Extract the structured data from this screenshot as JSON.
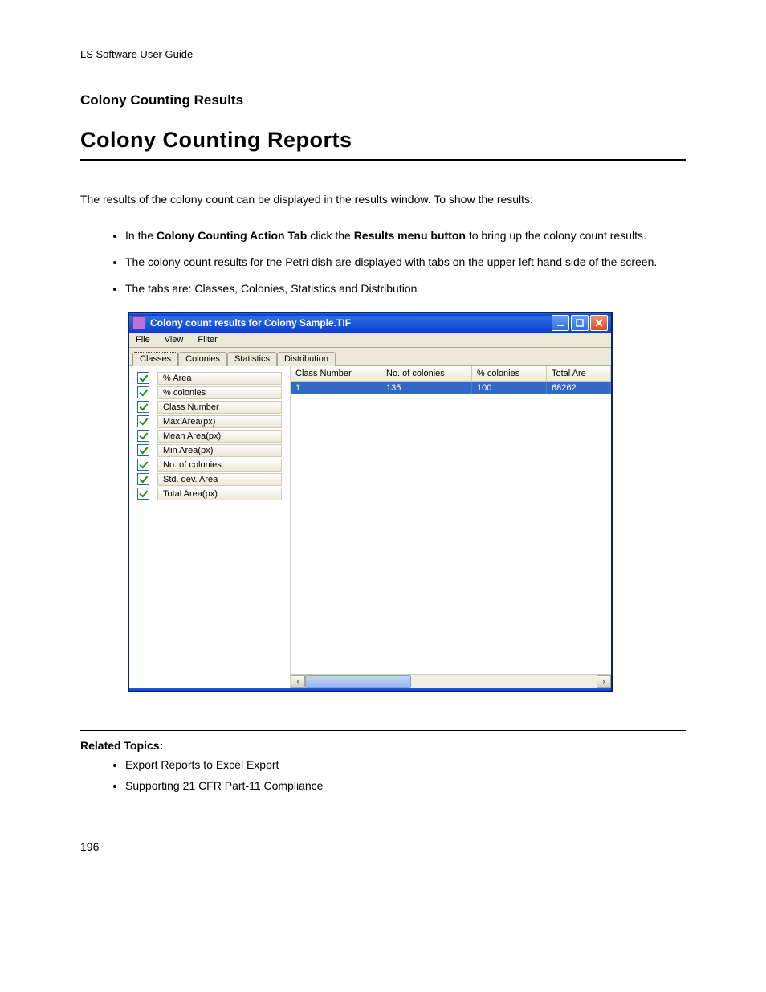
{
  "doc": {
    "header": "LS Software User Guide",
    "section_title": "Colony Counting Results",
    "main_title": "Colony Counting Reports",
    "intro": "The results of the colony count can be displayed in the results window. To show the results:",
    "bullets": {
      "b1_pre": "In the ",
      "b1_bold1": "Colony Counting Action Tab",
      "b1_mid": " click the ",
      "b1_bold2": "Results menu button",
      "b1_post": " to bring up the colony count results.",
      "b2": "The colony count results for the Petri dish are displayed with tabs on the upper left hand side of the screen.",
      "b3": "The tabs are: Classes, Colonies, Statistics and Distribution"
    },
    "related_title": "Related Topics:",
    "related": {
      "r1": "Export Reports to Excel Export",
      "r2": "Supporting 21 CFR Part-11 Compliance"
    },
    "page_number": "196"
  },
  "win": {
    "title": "Colony count results for Colony Sample.TIF",
    "menus": {
      "m1": "File",
      "m2": "View",
      "m3": "Filter"
    },
    "tabs": {
      "t1": "Classes",
      "t2": "Colonies",
      "t3": "Statistics",
      "t4": "Distribution"
    },
    "checks": {
      "c1": "% Area",
      "c2": "% colonies",
      "c3": "Class Number",
      "c4": "Max Area(px)",
      "c5": "Mean Area(px)",
      "c6": "Min Area(px)",
      "c7": "No. of colonies",
      "c8": "Std. dev. Area",
      "c9": "Total Area(px)"
    },
    "columns": {
      "h1": "Class Number",
      "h2": "No. of colonies",
      "h3": "% colonies",
      "h4": "Total Are"
    },
    "row1": {
      "v1": "1",
      "v2": "135",
      "v3": "100",
      "v4": "68262"
    }
  }
}
